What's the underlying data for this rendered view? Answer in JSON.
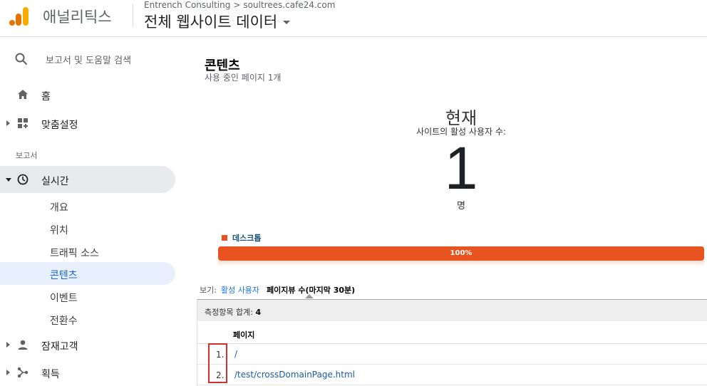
{
  "header": {
    "app_name": "애널리틱스",
    "breadcrumb_account": "Entrench Consulting",
    "breadcrumb_sep": ">",
    "breadcrumb_property": "soultrees.cafe24.com",
    "view_name": "전체 웹사이트 데이터",
    "logo_colors": [
      "#f9ab00",
      "#e37400"
    ]
  },
  "sidebar": {
    "search_label": "보고서 및 도움말 검색",
    "home_label": "홈",
    "customization_label": "맞춤설정",
    "section_reports": "보고서",
    "realtime_label": "실시간",
    "realtime_sub": [
      "개요",
      "위치",
      "트래픽 소스",
      "콘텐츠",
      "이벤트",
      "전환수"
    ],
    "active_sub": "콘텐츠",
    "audience_label": "잠재고객",
    "acquisition_label": "획득"
  },
  "main": {
    "title": "콘텐츠",
    "subtitle": "사용 중인 페이지 1개",
    "now_label": "현재",
    "active_users_label": "사이트의 활성 사용자 수:",
    "active_users_value": "1",
    "unit_label": "명",
    "legend_label": "데스크톱",
    "legend_color": "#e8531f",
    "device_share_label": "100%",
    "device_share_fraction": 1.0,
    "view_prefix": "보기:",
    "view_option_active_users": "활성 사용자",
    "view_option_pageviews": "페이지뷰 수(마지막 30분)",
    "summary_label": "측정항목 합계:",
    "summary_value": "4",
    "column_page": "페이지",
    "rows": [
      {
        "num": "1.",
        "path": "/"
      },
      {
        "num": "2.",
        "path": "/test/crossDomainPage.html"
      }
    ]
  }
}
